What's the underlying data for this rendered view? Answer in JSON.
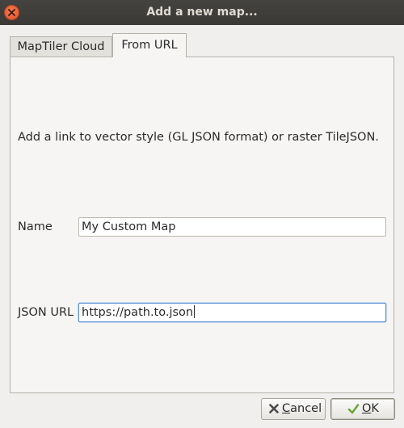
{
  "window": {
    "title": "Add a new map..."
  },
  "tabs": [
    {
      "label": "MapTiler Cloud",
      "active": false
    },
    {
      "label": "From URL",
      "active": true
    }
  ],
  "form": {
    "description": "Add a link to vector style (GL JSON format) or raster TileJSON.",
    "name_label": "Name",
    "name_value": "My Custom Map",
    "url_label": "JSON URL",
    "url_value": "https://path.to.json"
  },
  "buttons": {
    "cancel_mnemonic": "C",
    "cancel_rest": "ancel",
    "ok_mnemonic": "O",
    "ok_rest": "K"
  },
  "icons": {
    "close": "close-icon",
    "cancel": "x-icon",
    "ok": "checkmark-icon"
  },
  "colors": {
    "titlebar": "#3d3c39",
    "close_button": "#e9623a",
    "focus_border": "#5b92d6",
    "ok_check": "#66a62f",
    "cancel_x": "#4b4b4b"
  }
}
